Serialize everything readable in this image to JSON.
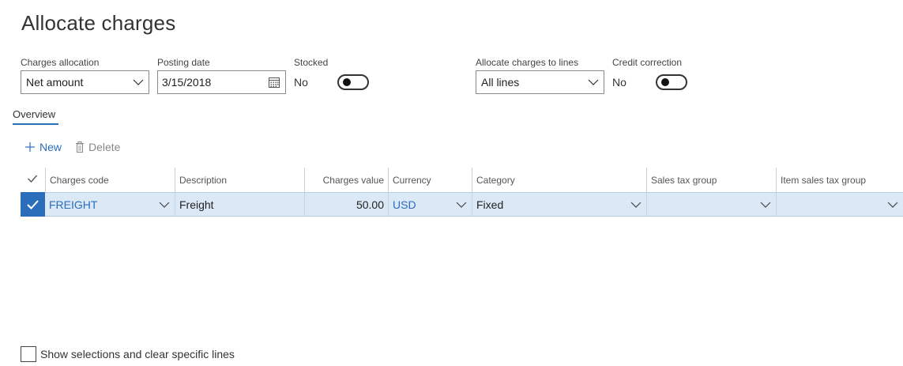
{
  "page": {
    "title": "Allocate charges"
  },
  "fields": {
    "charges_allocation": {
      "label": "Charges allocation",
      "value": "Net amount"
    },
    "posting_date": {
      "label": "Posting date",
      "value": "3/15/2018"
    },
    "stocked": {
      "label": "Stocked",
      "value": "No",
      "on": false
    },
    "allocate_lines": {
      "label": "Allocate charges to lines",
      "value": "All lines"
    },
    "credit_correction": {
      "label": "Credit correction",
      "value": "No",
      "on": false
    }
  },
  "tabs": {
    "overview": "Overview"
  },
  "actions": {
    "new": "New",
    "delete": "Delete"
  },
  "grid": {
    "columns": [
      "Charges code",
      "Description",
      "Charges value",
      "Currency",
      "Category",
      "Sales tax group",
      "Item sales tax group"
    ],
    "rows": [
      {
        "selected": true,
        "charges_code": "FREIGHT",
        "description": "Freight",
        "charges_value": "50.00",
        "currency": "USD",
        "category": "Fixed",
        "sales_tax_group": "",
        "item_sales_tax_group": ""
      }
    ]
  },
  "footer": {
    "show_selections_label": "Show selections and clear specific lines",
    "checked": false
  },
  "colors": {
    "accent": "#2a6ebb",
    "row_selected": "#dbe8f6"
  },
  "icons": {
    "new": "plus-icon",
    "delete": "trash-icon",
    "calendar": "calendar-icon",
    "dropdown": "chevron-down-icon",
    "check": "checkmark-icon"
  }
}
